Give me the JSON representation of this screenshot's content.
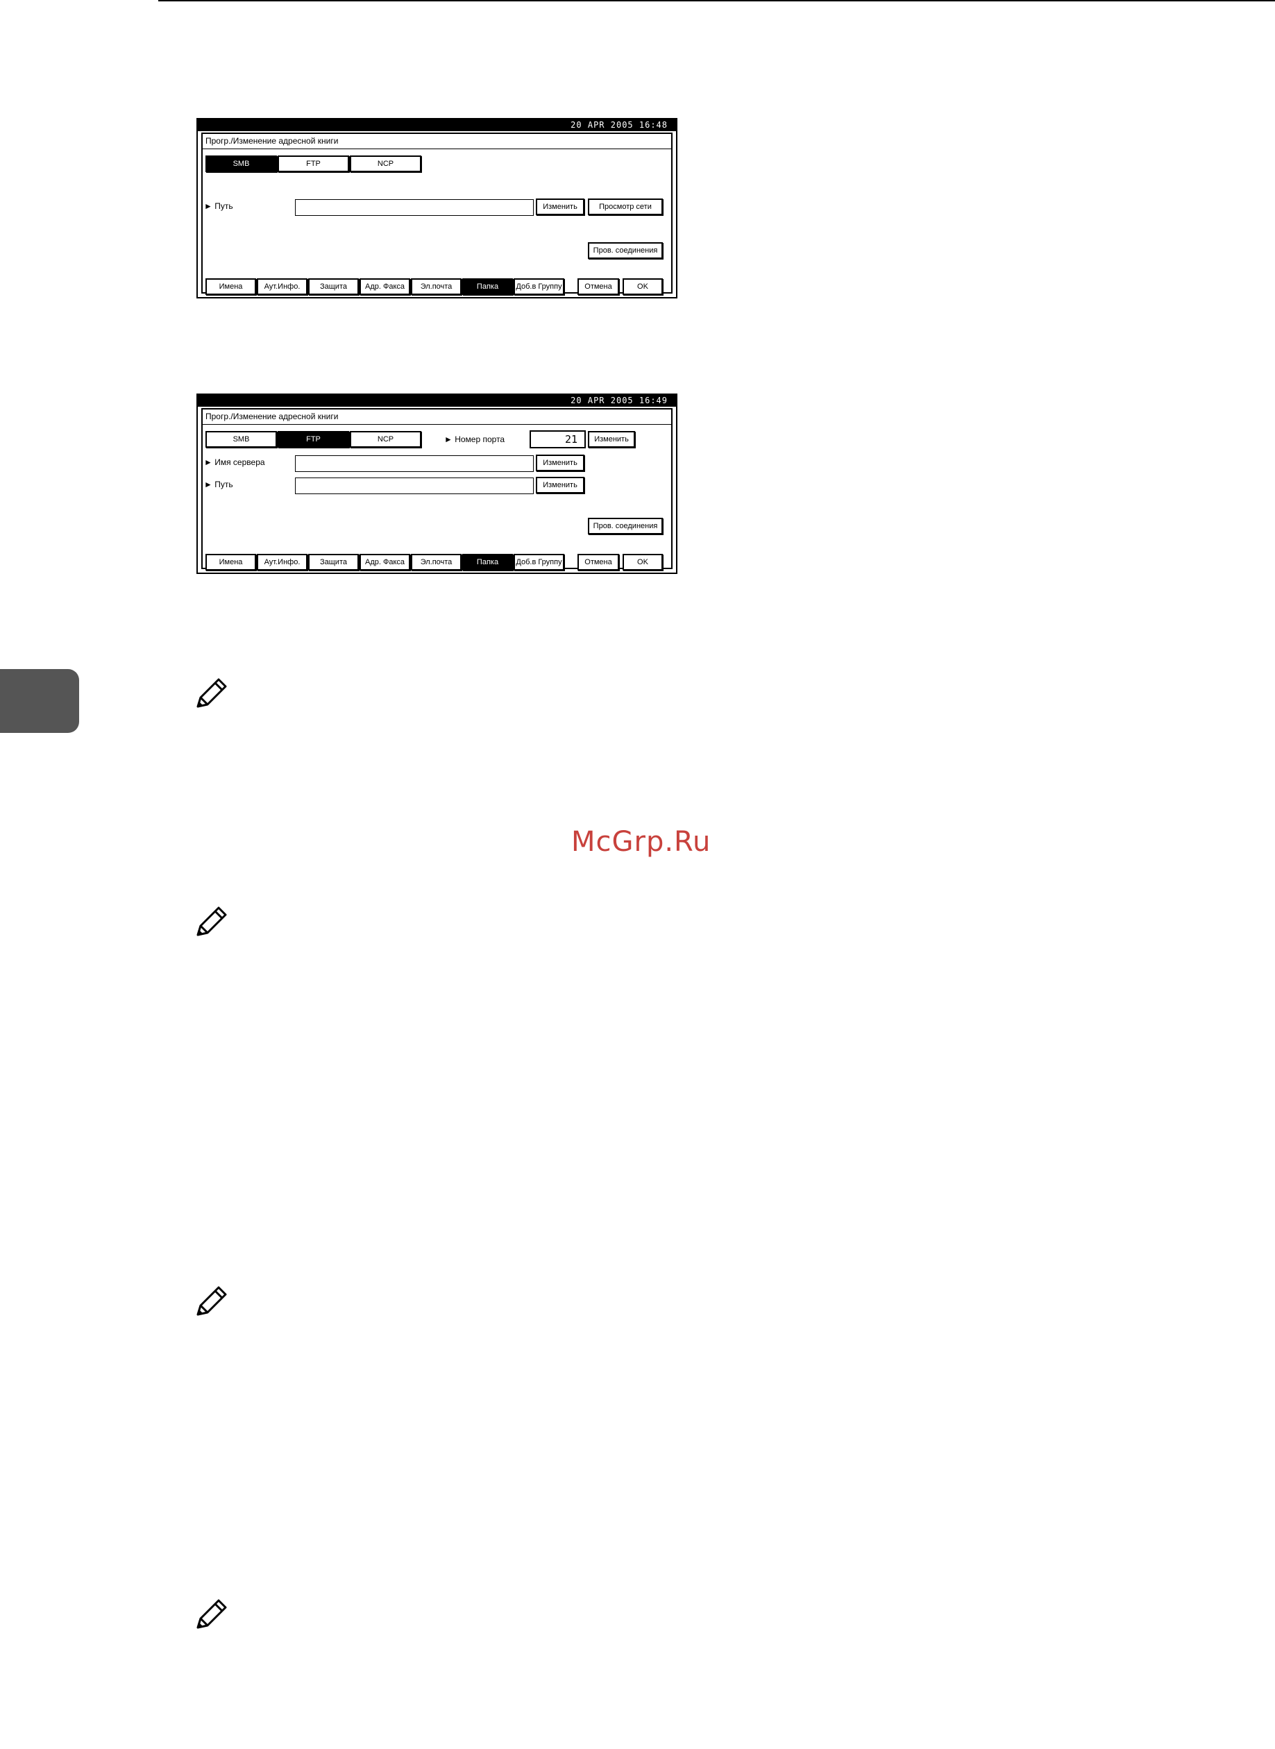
{
  "watermark": "McGrp.Ru",
  "panel_smb": {
    "datetime": "20 APR  2005 16:48",
    "title": "Прогр./Изменение адресной книги",
    "protocols": [
      "SMB",
      "FTP",
      "NCP"
    ],
    "path_label": "Путь",
    "change_label": "Изменить",
    "browse_label": "Просмотр сети",
    "conn_test_label": "Пров. соединения",
    "tabs": [
      "Имена",
      "Аут.Инфо.",
      "Защита",
      "Адр. Факса",
      "Эл.почта",
      "Папка",
      "Доб.в Группу"
    ],
    "cancel_label": "Отмена",
    "ok_label": "OK"
  },
  "panel_ftp": {
    "datetime": "20 APR  2005 16:49",
    "title": "Прогр./Изменение адресной книги",
    "protocols": [
      "SMB",
      "FTP",
      "NCP"
    ],
    "port_label": "Номер порта",
    "port_value": "21",
    "server_label": "Имя сервера",
    "path_label": "Путь",
    "change_label": "Изменить",
    "conn_test_label": "Пров. соединения",
    "tabs": [
      "Имена",
      "Аут.Инфо.",
      "Защита",
      "Адр. Факса",
      "Эл.почта",
      "Папка",
      "Доб.в Группу"
    ],
    "cancel_label": "Отмена",
    "ok_label": "OK"
  }
}
